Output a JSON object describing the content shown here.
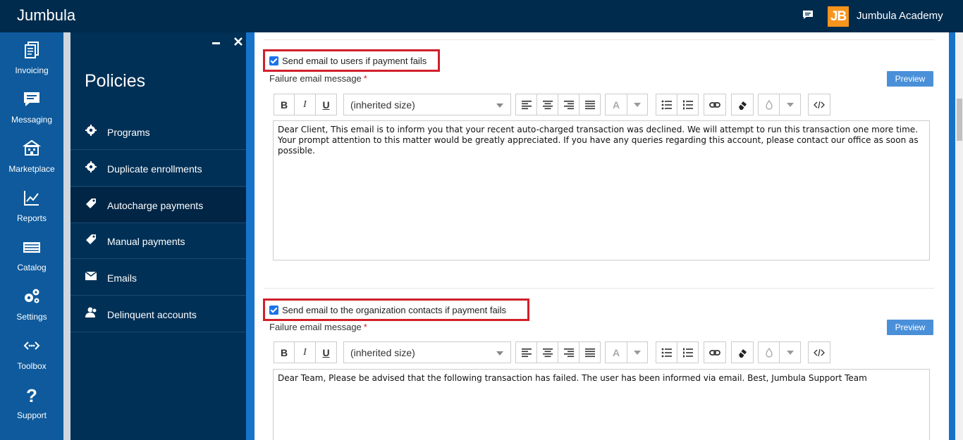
{
  "topbar": {
    "brand": "Jumbula",
    "org_logo_text": "JB",
    "org_name": "Jumbula Academy"
  },
  "rail": [
    {
      "label": "Invoicing",
      "icon": "invoicing-icon"
    },
    {
      "label": "Messaging",
      "icon": "messaging-icon"
    },
    {
      "label": "Marketplace",
      "icon": "marketplace-icon"
    },
    {
      "label": "Reports",
      "icon": "reports-icon"
    },
    {
      "label": "Catalog",
      "icon": "catalog-icon"
    },
    {
      "label": "Settings",
      "icon": "settings-icon"
    },
    {
      "label": "Toolbox",
      "icon": "toolbox-icon"
    },
    {
      "label": "Support",
      "icon": "support-icon"
    }
  ],
  "panel": {
    "title": "Policies",
    "items": [
      {
        "label": "Programs",
        "icon": "gear-icon"
      },
      {
        "label": "Duplicate enrollments",
        "icon": "gear-icon"
      },
      {
        "label": "Autocharge payments",
        "icon": "tag-icon",
        "active": true
      },
      {
        "label": "Manual payments",
        "icon": "tag-icon"
      },
      {
        "label": "Emails",
        "icon": "envelope-icon"
      },
      {
        "label": "Delinquent accounts",
        "icon": "user-alert-icon"
      }
    ]
  },
  "sections": [
    {
      "checkbox_label": "Send email to users if payment fails",
      "checked": true,
      "field_label": "Failure email message",
      "required_mark": "*",
      "preview_label": "Preview",
      "size_value": "(inherited size)",
      "message": "Dear Client, This email is to inform you that your recent auto-charged transaction was declined. We will attempt to run this transaction one more time. Your prompt attention to this matter would be greatly appreciated. If you have any queries regarding this account, please contact our office as soon as possible."
    },
    {
      "checkbox_label": "Send email to the organization contacts if payment fails",
      "checked": true,
      "field_label": "Failure email message",
      "required_mark": "*",
      "preview_label": "Preview",
      "size_value": "(inherited size)",
      "message": "Dear Team, Please be advised that the following transaction has failed. The user has been informed via email. Best, Jumbula Support Team"
    }
  ],
  "toolbar": {
    "bold": "B",
    "italic": "I",
    "underline": "U",
    "font_color": "A"
  },
  "colors": {
    "topbar": "#002b4d",
    "rail": "#0e5a9c",
    "panel": "#003056",
    "accent": "#1673c9",
    "highlight": "#d0202a",
    "org_logo": "#f7941d"
  }
}
